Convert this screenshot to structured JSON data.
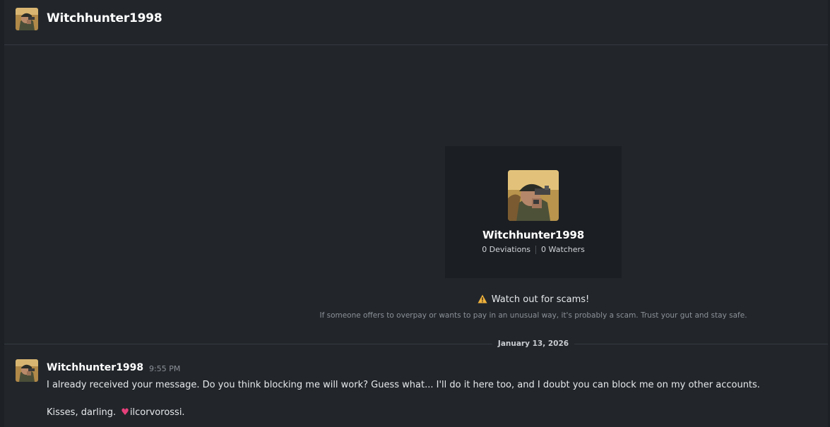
{
  "header": {
    "username": "Witchhunter1998"
  },
  "profile_card": {
    "username": "Witchhunter1998",
    "deviations": "0 Deviations",
    "watchers": "0 Watchers"
  },
  "scam_warning": {
    "title": "Watch out for scams!",
    "note": "If someone offers to overpay or wants to pay in an unusual way, it's probably a scam. Trust your gut and stay safe."
  },
  "date_divider": "January 13, 2026",
  "message": {
    "author": "Witchhunter1998",
    "time": "9:55 PM",
    "line1": "I already received your message. Do you think blocking me will work? Guess what... I'll do it here too, and I doubt you can block me on my other accounts.",
    "line2_prefix": "Kisses, darling.",
    "heart": "♥",
    "line2_suffix": "ilcorvorossi."
  },
  "colors": {
    "background": "#22262b",
    "card": "#1b1e22",
    "warning": "#f0b23c",
    "heart": "#e6407a"
  },
  "icons": {
    "warning": "warning-triangle-icon",
    "heart": "heart-emoji-icon"
  }
}
